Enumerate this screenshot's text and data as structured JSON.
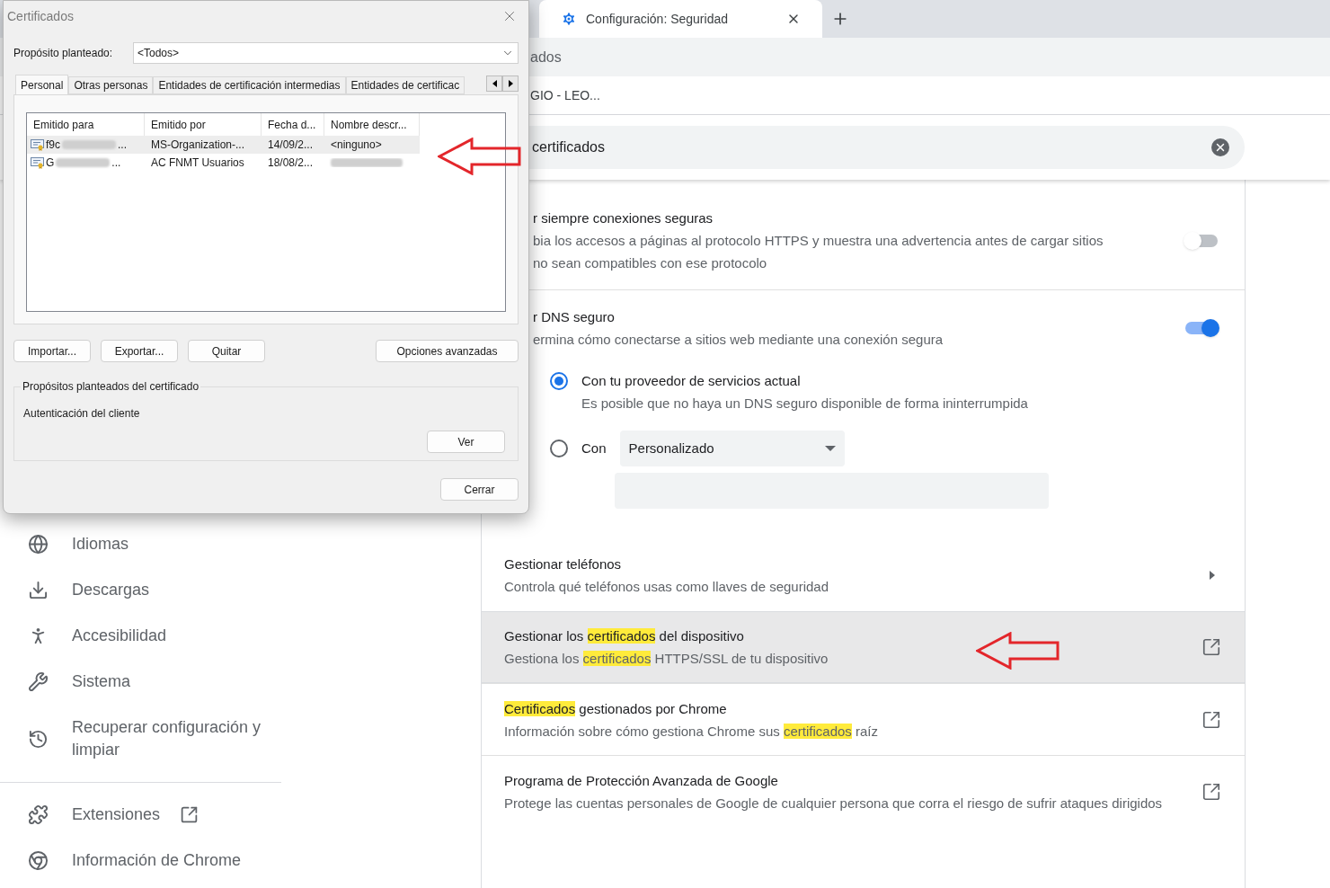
{
  "browser": {
    "tabs": [
      {
        "title": "Configuración: Seguridad",
        "selected": true
      }
    ],
    "bookmarks_text": "ados",
    "profile_text": "GIO - LEO...",
    "search": {
      "value": "certificados"
    }
  },
  "sidebar": {
    "items": [
      {
        "kind": "globe",
        "label": "Idiomas",
        "external": false
      },
      {
        "kind": "download",
        "label": "Descargas",
        "external": false
      },
      {
        "kind": "accessibility",
        "label": "Accesibilidad",
        "external": false
      },
      {
        "kind": "wrench",
        "label": "Sistema",
        "external": false
      },
      {
        "kind": "history",
        "label": "Recuperar configuración y limpiar",
        "external": false
      },
      {
        "kind": "divider"
      },
      {
        "kind": "puzzle",
        "label": "Extensiones",
        "external": true
      },
      {
        "kind": "chrome",
        "label": "Información de Chrome",
        "external": false
      }
    ]
  },
  "settings": {
    "rows": [
      {
        "kind": "toggle",
        "title": "r siempre conexiones seguras",
        "description_lines": [
          "bia los accesos a páginas al protocolo HTTPS y muestra una advertencia antes de cargar sitios",
          "no sean compatibles con ese protocolo"
        ],
        "on": false
      },
      {
        "kind": "toggle",
        "title": "r DNS seguro",
        "description_lines": [
          "ermina cómo conectarse a sitios web mediante una conexión segura"
        ],
        "on": true,
        "options": [
          {
            "kind": "text",
            "label": "Con tu proveedor de servicios actual",
            "description": "Es posible que no haya un DNS seguro disponible de forma ininterrumpida",
            "selected": true
          },
          {
            "kind": "select",
            "label": "Con",
            "select_value": "Personalizado",
            "selected": false
          }
        ]
      },
      {
        "kind": "submenu",
        "hovered": false,
        "title": [
          {
            "text": "Gestionar teléfonos",
            "highlighted": false
          }
        ],
        "description": [
          {
            "text": "Controla qué teléfonos usas como llaves de seguridad",
            "highlighted": false
          }
        ]
      },
      {
        "kind": "external",
        "hovered": true,
        "title": [
          {
            "text": "Gestionar los ",
            "highlighted": false
          },
          {
            "text": "certificados",
            "highlighted": true
          },
          {
            "text": " del dispositivo",
            "highlighted": false
          }
        ],
        "description": [
          {
            "text": "Gestiona los ",
            "highlighted": false
          },
          {
            "text": "certificados",
            "highlighted": true
          },
          {
            "text": " HTTPS/SSL de tu dispositivo",
            "highlighted": false
          }
        ]
      },
      {
        "kind": "external",
        "hovered": false,
        "title": [
          {
            "text": "Certificados",
            "highlighted": true
          },
          {
            "text": " gestionados por Chrome",
            "highlighted": false
          }
        ],
        "description": [
          {
            "text": "Información sobre cómo gestiona Chrome sus ",
            "highlighted": false
          },
          {
            "text": "certificados",
            "highlighted": true
          },
          {
            "text": " raíz",
            "highlighted": false
          }
        ]
      },
      {
        "kind": "external",
        "hovered": false,
        "title": [
          {
            "text": "Programa de Protección Avanzada de Google",
            "highlighted": false
          }
        ],
        "description": [
          {
            "text": "Protege las cuentas personales de Google de cualquier persona que corra el riesgo de sufrir ataques dirigidos",
            "highlighted": false
          }
        ]
      }
    ]
  },
  "dialog": {
    "title": "Certificados",
    "purpose_label": "Propósito planteado:",
    "purpose_value": "<Todos>",
    "tabs": [
      {
        "label": "Personal",
        "selected": true
      },
      {
        "label": "Otras personas",
        "selected": false
      },
      {
        "label": "Entidades de certificación intermedias",
        "selected": false
      },
      {
        "label": "Entidades de certificac",
        "selected": false
      }
    ],
    "columns": [
      "Emitido para",
      "Emitido por",
      "Fecha d...",
      "Nombre descr..."
    ],
    "rows": [
      {
        "selected": true,
        "cells": [
          {
            "text": "f9c",
            "redacted": true,
            "suffix": "..."
          },
          {
            "text": "MS-Organization-...",
            "redacted": false
          },
          {
            "text": "14/09/2...",
            "redacted": false
          },
          {
            "text": "<ninguno>",
            "redacted": false
          }
        ]
      },
      {
        "selected": false,
        "cells": [
          {
            "text": "G",
            "redacted": true,
            "suffix": "..."
          },
          {
            "text": "AC FNMT Usuarios",
            "redacted": false
          },
          {
            "text": "18/08/2...",
            "redacted": false
          },
          {
            "redacted": true
          }
        ]
      }
    ],
    "buttons": [
      "Importar...",
      "Exportar...",
      "Quitar"
    ],
    "advanced_button": "Opciones avanzadas",
    "group_title": "Propósitos planteados del certificado",
    "group_text": "Autenticación del cliente",
    "view_button": "Ver",
    "close_button": "Cerrar"
  }
}
